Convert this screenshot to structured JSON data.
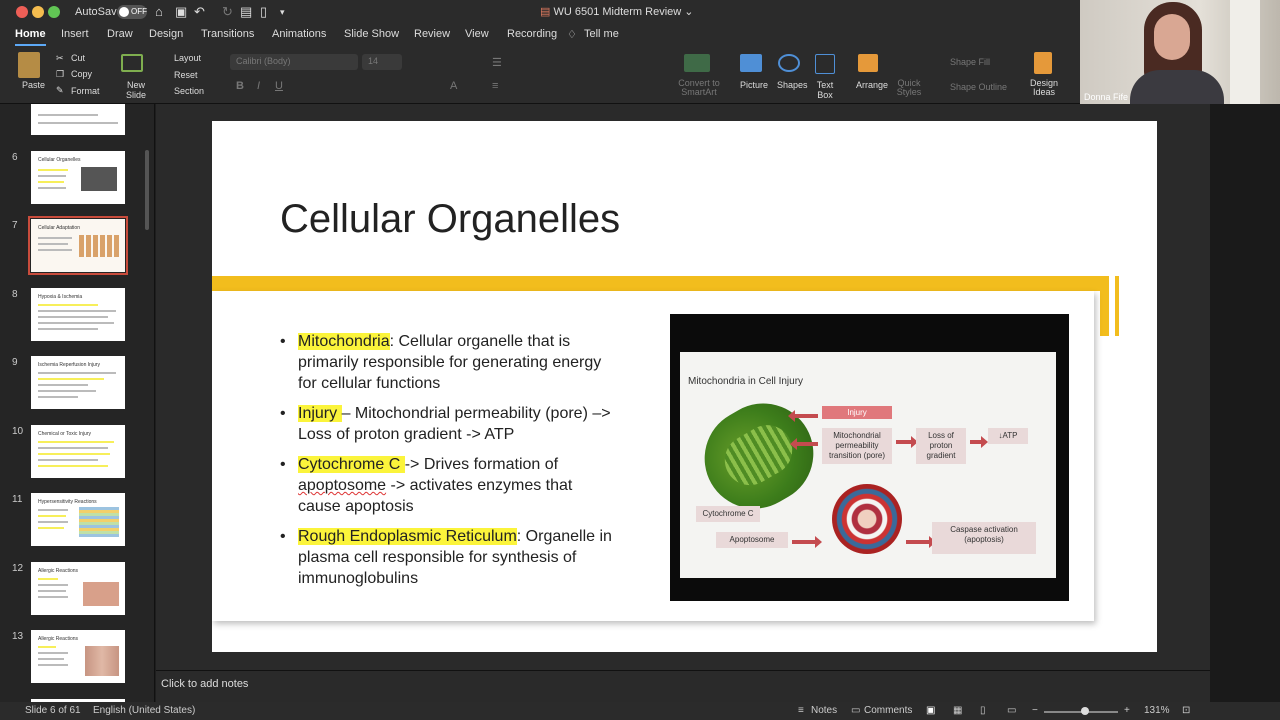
{
  "window": {
    "autosave_label": "AutoSave",
    "autosave_state": "OFF",
    "title": "WU 6501 Midterm Review"
  },
  "tabs": [
    "Home",
    "Insert",
    "Draw",
    "Design",
    "Transitions",
    "Animations",
    "Slide Show",
    "Review",
    "View",
    "Recording"
  ],
  "tell_me": "Tell me",
  "ribbon": {
    "paste": "Paste",
    "cut": "Cut",
    "copy": "Copy",
    "format": "Format",
    "new_slide": "New Slide",
    "layout": "Layout",
    "reset": "Reset",
    "section": "Section",
    "font_name": "Calibri (Body)",
    "font_size": "14",
    "convert_smartart": "Convert to SmartArt",
    "picture": "Picture",
    "shapes": "Shapes",
    "text_box": "Text Box",
    "arrange": "Arrange",
    "quick_styles": "Quick Styles",
    "shape_fill": "Shape Fill",
    "shape_outline": "Shape Outline",
    "design_ideas": "Design Ideas"
  },
  "video": {
    "participant_name": "Donna Fife"
  },
  "thumbnails": [
    {
      "num": "6",
      "title": "Cellular Organelles"
    },
    {
      "num": "7",
      "title": "Cellular Adaptation"
    },
    {
      "num": "8",
      "title": "Hypoxia & Ischemia"
    },
    {
      "num": "9",
      "title": "Ischemia Reperfusion Injury"
    },
    {
      "num": "10",
      "title": "Chemical or Toxic Injury"
    },
    {
      "num": "11",
      "title": "Hypersensitivity Reactions"
    },
    {
      "num": "12",
      "title": "Allergic Reactions"
    },
    {
      "num": "13",
      "title": "Allergic Reactions"
    }
  ],
  "slide": {
    "title": "Cellular Organelles",
    "bullets": [
      {
        "term": "Mitochondria",
        "rest": ": Cellular organelle that is primarily responsible for generating energy for cellular functions"
      },
      {
        "term": "Injury ",
        "rest": "– Mitochondrial permeability (pore) –> Loss of proton gradient -> ATP"
      },
      {
        "term": "Cytochrome C ",
        "rest_a": "-> Drives formation of ",
        "rest_b": "apoptosome",
        "rest_c": " -> activates enzymes that cause apoptosis"
      },
      {
        "term": "Rough Endoplasmic Reticulum",
        "rest": ": Organelle in plasma cell responsible for synthesis of immunoglobulins"
      }
    ],
    "figure": {
      "title": "Mitochondria in Cell Injury",
      "injury": "Injury",
      "mpt": "Mitochondrial permeability transition (pore)",
      "loss": "Loss of proton gradient",
      "atp": "↓ATP",
      "cytc": "Cytochrome C",
      "apoptosome": "Apoptosome",
      "caspase": "Caspase activation (apoptosis)"
    }
  },
  "notes_placeholder": "Click to add notes",
  "status": {
    "slide_of": "Slide 6 of 61",
    "language": "English (United States)",
    "notes": "Notes",
    "comments": "Comments",
    "zoom": "131%"
  },
  "colors": {
    "accent_yellow": "#f2bd1d",
    "highlight": "#fbf43b",
    "selection_red": "#c94c3c",
    "tab_underline": "#5da9f6"
  }
}
